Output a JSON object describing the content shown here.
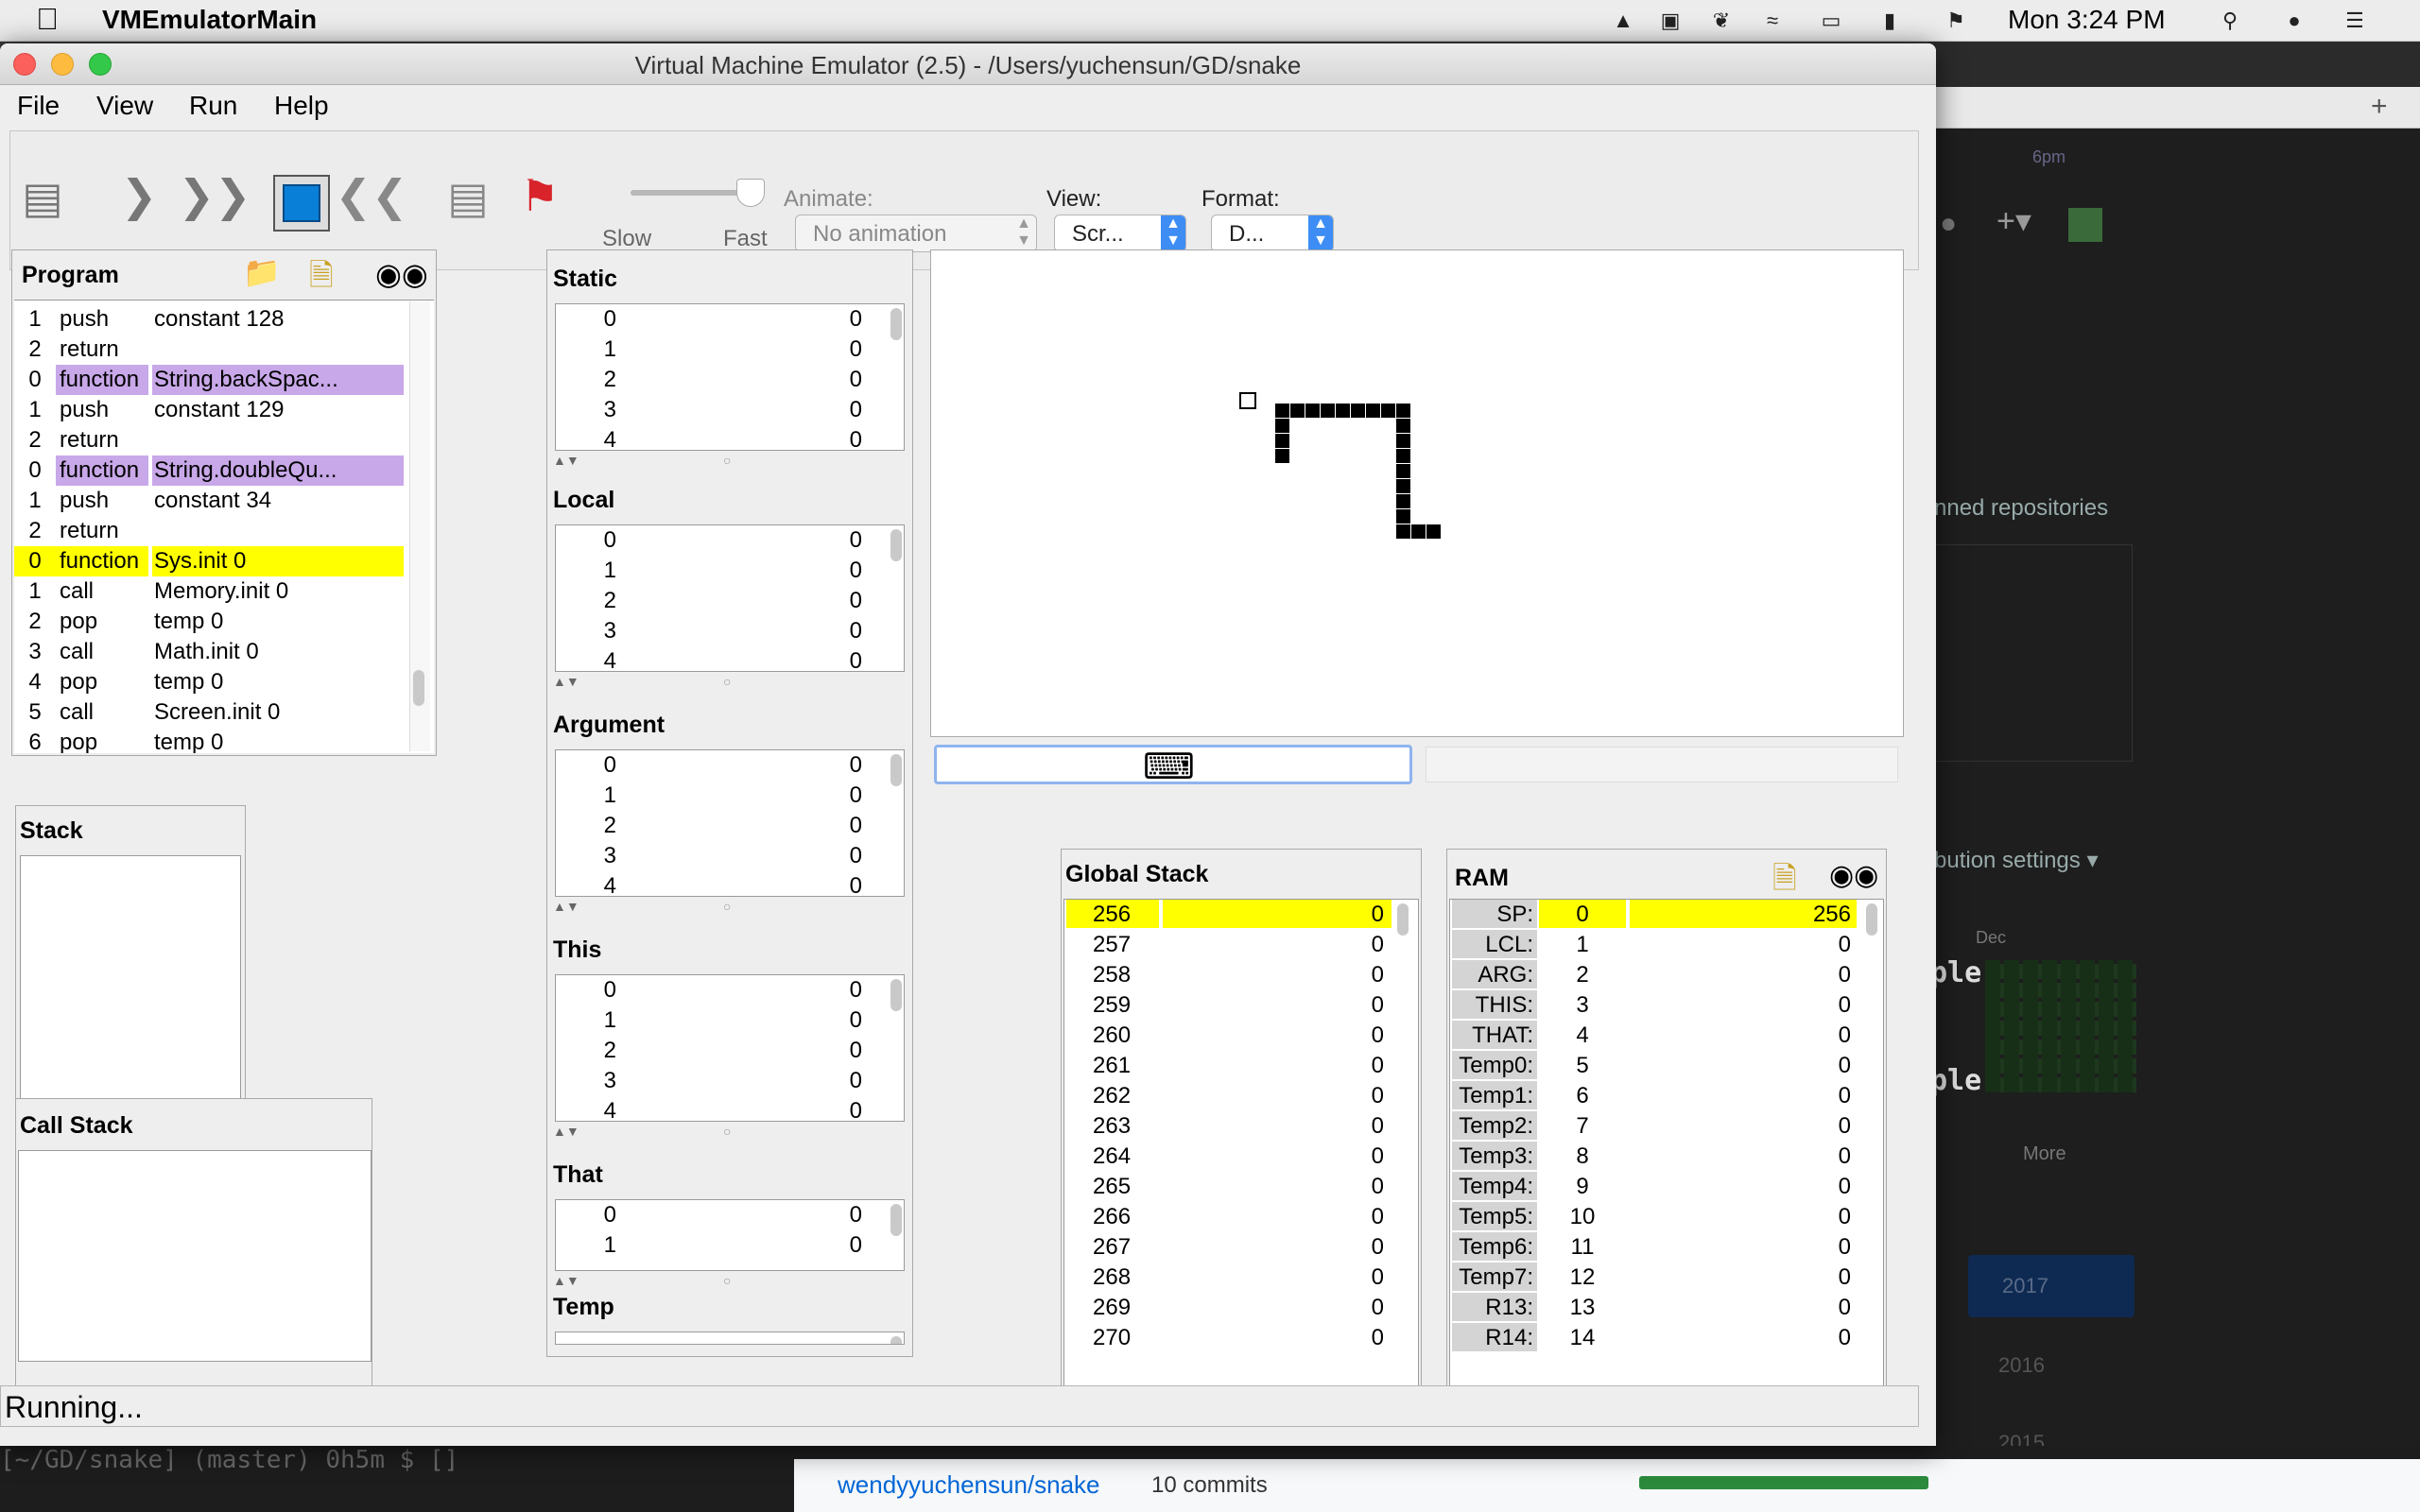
{
  "menubar": {
    "app_name": "VMEmulatorMain",
    "clock": "Mon 3:24 PM"
  },
  "background": {
    "pinned": "nned repositories",
    "contrib": "bution settings ▾",
    "ple1": "ple",
    "ple2": "ple",
    "more": "More",
    "dec": "Dec",
    "y2017": "2017",
    "y2016": "2016",
    "y2015": "2015",
    "terminal": "[~/GD/snake] (master) 0h5m $ []",
    "repo": "wendyyuchensun/snake",
    "commits": "10 commits",
    "tabs": "6pm"
  },
  "window": {
    "title": "Virtual Machine Emulator (2.5) - /Users/yuchensun/GD/snake"
  },
  "menus": [
    "File",
    "View",
    "Run",
    "Help"
  ],
  "toolbar": {
    "slow": "Slow",
    "fast": "Fast",
    "animate_label": "Animate:",
    "animate_value": "No animation",
    "view_label": "View:",
    "view_value": "Scr...",
    "format_label": "Format:",
    "format_value": "D..."
  },
  "program": {
    "title": "Program",
    "rows": [
      {
        "n": "1",
        "cmd": "push",
        "arg": "constant 128",
        "hl": ""
      },
      {
        "n": "2",
        "cmd": "return",
        "arg": "",
        "hl": ""
      },
      {
        "n": "0",
        "cmd": "function",
        "arg": "String.backSpac...",
        "hl": "fn"
      },
      {
        "n": "1",
        "cmd": "push",
        "arg": "constant 129",
        "hl": ""
      },
      {
        "n": "2",
        "cmd": "return",
        "arg": "",
        "hl": ""
      },
      {
        "n": "0",
        "cmd": "function",
        "arg": "String.doubleQu...",
        "hl": "fn"
      },
      {
        "n": "1",
        "cmd": "push",
        "arg": "constant 34",
        "hl": ""
      },
      {
        "n": "2",
        "cmd": "return",
        "arg": "",
        "hl": ""
      },
      {
        "n": "0",
        "cmd": "function",
        "arg": "Sys.init 0",
        "hl": "cur"
      },
      {
        "n": "1",
        "cmd": "call",
        "arg": "Memory.init 0",
        "hl": ""
      },
      {
        "n": "2",
        "cmd": "pop",
        "arg": "temp 0",
        "hl": ""
      },
      {
        "n": "3",
        "cmd": "call",
        "arg": "Math.init 0",
        "hl": ""
      },
      {
        "n": "4",
        "cmd": "pop",
        "arg": "temp 0",
        "hl": ""
      },
      {
        "n": "5",
        "cmd": "call",
        "arg": "Screen.init 0",
        "hl": ""
      },
      {
        "n": "6",
        "cmd": "pop",
        "arg": "temp 0",
        "hl": ""
      }
    ]
  },
  "stack": {
    "title": "Stack"
  },
  "callstack": {
    "title": "Call Stack"
  },
  "segments": [
    {
      "title": "Static",
      "rows": [
        [
          "0",
          "0"
        ],
        [
          "1",
          "0"
        ],
        [
          "2",
          "0"
        ],
        [
          "3",
          "0"
        ],
        [
          "4",
          "0"
        ]
      ]
    },
    {
      "title": "Local",
      "rows": [
        [
          "0",
          "0"
        ],
        [
          "1",
          "0"
        ],
        [
          "2",
          "0"
        ],
        [
          "3",
          "0"
        ],
        [
          "4",
          "0"
        ]
      ]
    },
    {
      "title": "Argument",
      "rows": [
        [
          "0",
          "0"
        ],
        [
          "1",
          "0"
        ],
        [
          "2",
          "0"
        ],
        [
          "3",
          "0"
        ],
        [
          "4",
          "0"
        ]
      ]
    },
    {
      "title": "This",
      "rows": [
        [
          "0",
          "0"
        ],
        [
          "1",
          "0"
        ],
        [
          "2",
          "0"
        ],
        [
          "3",
          "0"
        ],
        [
          "4",
          "0"
        ]
      ]
    },
    {
      "title": "That",
      "rows": [
        [
          "0",
          "0"
        ],
        [
          "1",
          "0"
        ]
      ]
    },
    {
      "title": "Temp",
      "rows": []
    }
  ],
  "global_stack": {
    "title": "Global Stack",
    "rows": [
      [
        "256",
        "0"
      ],
      [
        "257",
        "0"
      ],
      [
        "258",
        "0"
      ],
      [
        "259",
        "0"
      ],
      [
        "260",
        "0"
      ],
      [
        "261",
        "0"
      ],
      [
        "262",
        "0"
      ],
      [
        "263",
        "0"
      ],
      [
        "264",
        "0"
      ],
      [
        "265",
        "0"
      ],
      [
        "266",
        "0"
      ],
      [
        "267",
        "0"
      ],
      [
        "268",
        "0"
      ],
      [
        "269",
        "0"
      ],
      [
        "270",
        "0"
      ]
    ]
  },
  "ram": {
    "title": "RAM",
    "rows": [
      [
        "SP:",
        "0",
        "256"
      ],
      [
        "LCL:",
        "1",
        "0"
      ],
      [
        "ARG:",
        "2",
        "0"
      ],
      [
        "THIS:",
        "3",
        "0"
      ],
      [
        "THAT:",
        "4",
        "0"
      ],
      [
        "Temp0:",
        "5",
        "0"
      ],
      [
        "Temp1:",
        "6",
        "0"
      ],
      [
        "Temp2:",
        "7",
        "0"
      ],
      [
        "Temp3:",
        "8",
        "0"
      ],
      [
        "Temp4:",
        "9",
        "0"
      ],
      [
        "Temp5:",
        "10",
        "0"
      ],
      [
        "Temp6:",
        "11",
        "0"
      ],
      [
        "Temp7:",
        "12",
        "0"
      ],
      [
        "R13:",
        "13",
        "0"
      ],
      [
        "R14:",
        "14",
        "0"
      ]
    ]
  },
  "status": "Running...",
  "colors": {
    "current_line": "#ffff00",
    "function_row": "#c8a8e8",
    "close": "#fc605c",
    "minimize": "#fdbc40",
    "zoom": "#34c84a"
  }
}
